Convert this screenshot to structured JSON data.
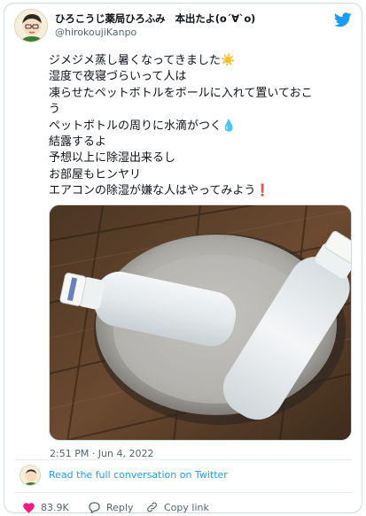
{
  "author": {
    "display_name": "ひろこうじ薬局ひろふみ　本出たよ(oˊ∀ˋo)",
    "handle": "@hirokoujiKanpo"
  },
  "tweet": {
    "lines": [
      "ジメジメ蒸し暑くなってきました☀️",
      "湿度で夜寝づらいって人は",
      "凍らせたペットボトルをボールに入れて置いておこ",
      "う",
      "ペットボトルの周りに水滴がつく💧",
      "結露するよ",
      "予想以上に除湿出来るし",
      "お部屋もヒンヤリ",
      "エアコンの除湿が嫌な人はやってみよう❗"
    ]
  },
  "timestamp": "2:51 PM · Jun 4, 2022",
  "conversation_link": "Read the full conversation on Twitter",
  "actions": {
    "like_count": "83.9K",
    "reply_label": "Reply",
    "copy_label": "Copy link"
  },
  "colors": {
    "twitter_blue": "#1d9bf0",
    "like_red": "#f91880",
    "text_primary": "#0f1419",
    "text_secondary": "#536471"
  },
  "icons": [
    "twitter-bird-icon",
    "heart-icon",
    "reply-icon",
    "link-icon"
  ]
}
